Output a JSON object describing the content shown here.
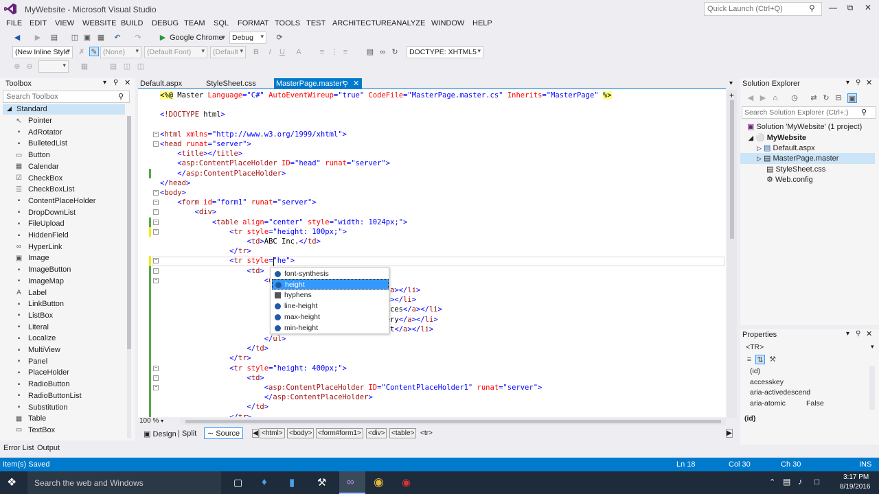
{
  "app": {
    "title": "MyWebsite - Microsoft Visual Studio",
    "quick_launch": "Quick Launch (Ctrl+Q)"
  },
  "menu": [
    "FILE",
    "EDIT",
    "VIEW",
    "WEBSITE",
    "BUILD",
    "DEBUG",
    "TEAM",
    "SQL",
    "FORMAT",
    "TOOLS",
    "TEST",
    "ARCHITECTURE",
    "ANALYZE",
    "WINDOW",
    "HELP"
  ],
  "toolbar": {
    "run_target": "Google Chrome",
    "config": "Debug",
    "style_combo": "(New Inline Style",
    "none_combo": "(None)",
    "font_combo": "(Default Font)",
    "size_combo": "(Default",
    "doctype": "DOCTYPE: XHTML5"
  },
  "toolbox": {
    "title": "Toolbox",
    "search_placeholder": "Search Toolbox",
    "group": "Standard",
    "items": [
      "Pointer",
      "AdRotator",
      "BulletedList",
      "Button",
      "Calendar",
      "CheckBox",
      "CheckBoxList",
      "ContentPlaceHolder",
      "DropDownList",
      "FileUpload",
      "HiddenField",
      "HyperLink",
      "Image",
      "ImageButton",
      "ImageMap",
      "Label",
      "LinkButton",
      "ListBox",
      "Literal",
      "Localize",
      "MultiView",
      "Panel",
      "PlaceHolder",
      "RadioButton",
      "RadioButtonList",
      "Substitution",
      "Table",
      "TextBox"
    ]
  },
  "tabs": [
    "Default.aspx",
    "StyleSheet.css",
    "MasterPage.master*"
  ],
  "code_lines": [
    "<%@ Master Language=\"C#\" AutoEventWireup=\"true\" CodeFile=\"MasterPage.master.cs\" Inherits=\"MasterPage\" %>",
    "",
    "<!DOCTYPE html>",
    "",
    "<html xmlns=\"http://www.w3.org/1999/xhtml\">",
    "<head runat=\"server\">",
    "    <title></title>",
    "    <asp:ContentPlaceHolder ID=\"head\" runat=\"server\">",
    "    </asp:ContentPlaceHolder>",
    "</head>",
    "<body>",
    "    <form id=\"form1\" runat=\"server\">",
    "        <div>",
    "            <table align=\"center\" style=\"width: 1024px;\">",
    "                <tr style=\"height: 100px;\">",
    "                    <td>ABC Inc.</td>",
    "                </tr>",
    "                <tr style=\"he\">",
    "                    <td>",
    "                        <ul",
    "                                                  e</a></li>",
    "                                                  </a></li>",
    "                                                  rvices</a></li>",
    "                                                  llery</a></li>",
    "                                                  tact</a></li>",
    "                        </ul>",
    "                    </td>",
    "                </tr>",
    "                <tr style=\"height: 400px;\">",
    "                    <td>",
    "                        <asp:ContentPlaceHolder ID=\"ContentPlaceHolder1\" runat=\"server\">",
    "                        </asp:ContentPlaceHolder>",
    "                    </td>",
    "                </tr>"
  ],
  "intellisense": {
    "items": [
      "font-synthesis",
      "height",
      "hyphens",
      "line-height",
      "max-height",
      "min-height"
    ],
    "selected": 1
  },
  "editor_bottom": {
    "zoom": "100 %",
    "design": "Design",
    "split": "Split",
    "source": "Source",
    "crumbs": [
      "<html>",
      "<body>",
      "<form#form1>",
      "<div>",
      "<table>",
      "<tr>"
    ]
  },
  "solution_explorer": {
    "title": "Solution Explorer",
    "search_placeholder": "Search Solution Explorer (Ctrl+;)",
    "solution": "Solution 'MyWebsite' (1 project)",
    "project": "MyWebsite",
    "files": [
      "Default.aspx",
      "MasterPage.master",
      "StyleSheet.css",
      "Web.config"
    ]
  },
  "properties": {
    "title": "Properties",
    "object": "<TR>",
    "rows": [
      {
        "name": "(id)",
        "value": ""
      },
      {
        "name": "accesskey",
        "value": ""
      },
      {
        "name": "aria-activedescend",
        "value": ""
      },
      {
        "name": "aria-atomic",
        "value": "False"
      }
    ],
    "footer": "(id)"
  },
  "bottom_tabs": [
    "Error List",
    "Output"
  ],
  "status": {
    "left": "Item(s) Saved",
    "ln": "Ln 18",
    "col": "Col 30",
    "ch": "Ch 30",
    "mode": "INS"
  },
  "taskbar": {
    "search": "Search the web and Windows",
    "time": "3:17 PM",
    "date": "8/19/2016"
  },
  "colors": {
    "accent": "#007acc",
    "selection": "#3399ff",
    "taskbar": "#1d2b3a"
  }
}
